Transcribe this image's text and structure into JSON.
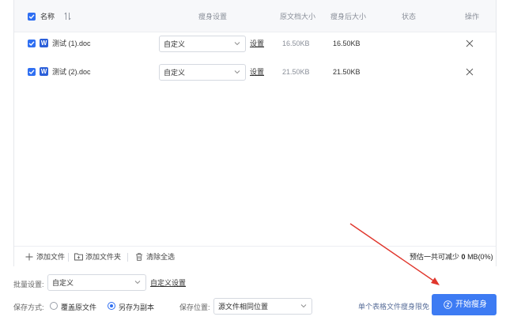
{
  "table": {
    "headers": {
      "name": "名称",
      "settings": "瘦身设置",
      "original_size": "原文档大小",
      "after_size": "瘦身后大小",
      "status": "状态",
      "action": "操作"
    },
    "rows": [
      {
        "name": "测试 (1).doc",
        "mode": "自定义",
        "setting_link": "设置",
        "original": "16.50KB",
        "after": "16.50KB",
        "status": ""
      },
      {
        "name": "测试 (2).doc",
        "mode": "自定义",
        "setting_link": "设置",
        "original": "21.50KB",
        "after": "21.50KB",
        "status": ""
      }
    ]
  },
  "toolbar": {
    "add_file": "添加文件",
    "add_folder": "添加文件夹",
    "clear_all": "清除全选",
    "estimate_prefix": "预估一共可减少",
    "estimate_value": "0",
    "estimate_suffix": "MB(0%)"
  },
  "batch": {
    "label": "批量设置:",
    "mode": "自定义",
    "custom_link": "自定义设置"
  },
  "save": {
    "label": "保存方式:",
    "overwrite": "覆盖原文件",
    "copy": "另存为副本",
    "selected": "copy",
    "location_label": "保存位置:",
    "location_value": "源文件相同位置"
  },
  "limit_text": "单个表格文件瘦身限免",
  "start_button": "开始瘦身",
  "colors": {
    "accent": "#2f6ff2",
    "button": "#3d7bf3",
    "arrow": "#e0362c"
  }
}
